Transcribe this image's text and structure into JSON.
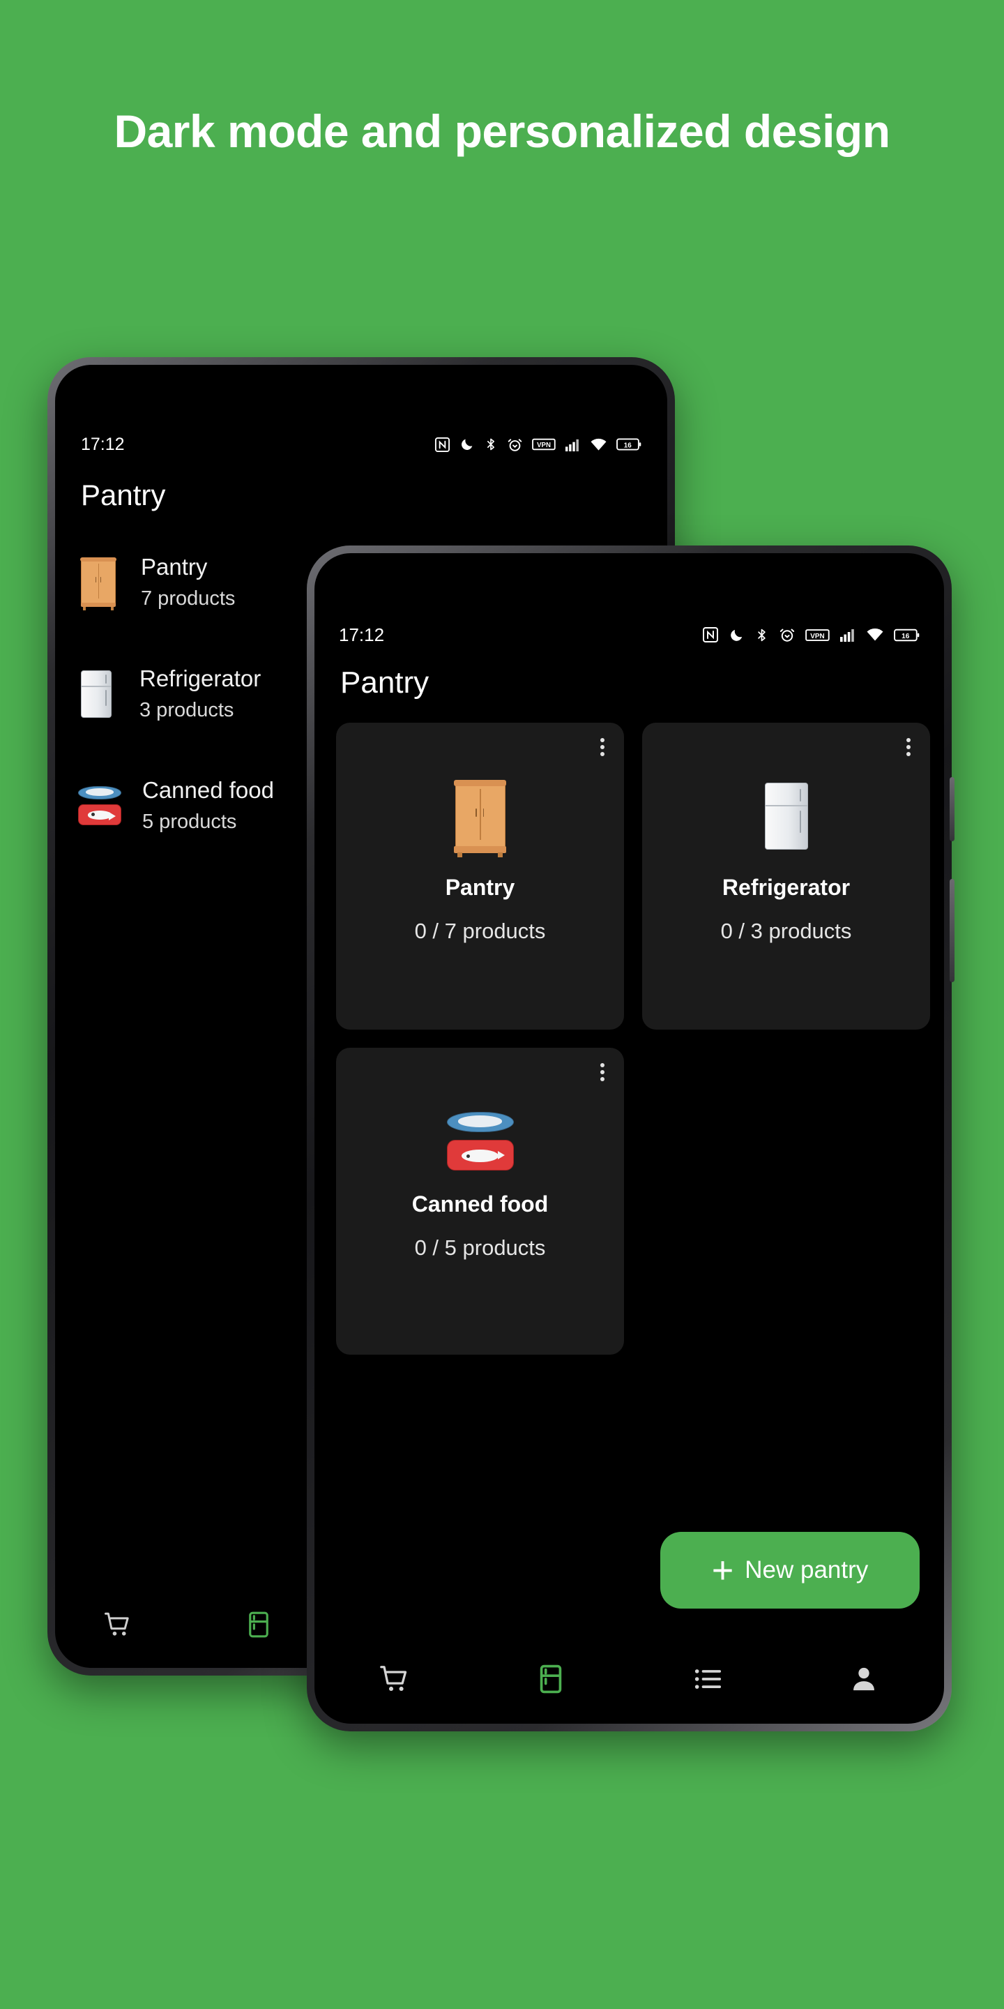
{
  "page": {
    "headline": "Dark mode and personalized design",
    "background_color": "#4CAF50",
    "accent_color": "#4CAF50",
    "surface_color": "#1b1b1b",
    "screen_background": "#000000"
  },
  "back_phone": {
    "statusbar": {
      "time": "17:12",
      "battery_label": "16",
      "icons": [
        "nfc-icon",
        "dnd-moon-icon",
        "bluetooth-icon",
        "alarm-icon",
        "vpn-icon",
        "cellular-signal-icon",
        "wifi-icon",
        "battery-icon"
      ]
    },
    "appbar": {
      "title": "Pantry"
    },
    "list": [
      {
        "emoji": "cabinet",
        "title": "Pantry",
        "subtitle": "7 products"
      },
      {
        "emoji": "fridge",
        "title": "Refrigerator",
        "subtitle": "3 products"
      },
      {
        "emoji": "can",
        "title": "Canned food",
        "subtitle": "5 products"
      }
    ],
    "bottomnav": [
      {
        "icon": "cart-icon",
        "active": false
      },
      {
        "icon": "fridge-nav-icon",
        "active": true
      }
    ]
  },
  "front_phone": {
    "statusbar": {
      "time": "17:12",
      "battery_label": "16",
      "icons": [
        "nfc-icon",
        "dnd-moon-icon",
        "bluetooth-icon",
        "alarm-icon",
        "vpn-icon",
        "cellular-signal-icon",
        "wifi-icon",
        "battery-icon"
      ]
    },
    "appbar": {
      "title": "Pantry"
    },
    "cards": [
      {
        "emoji": "cabinet",
        "title": "Pantry",
        "subtitle": "0 / 7 products"
      },
      {
        "emoji": "fridge",
        "title": "Refrigerator",
        "subtitle": "0 / 3 products"
      },
      {
        "emoji": "can",
        "title": "Canned food",
        "subtitle": "0 / 5 products"
      }
    ],
    "fab": {
      "plus": "+",
      "label": "New pantry"
    },
    "bottomnav": [
      {
        "icon": "cart-icon",
        "active": false
      },
      {
        "icon": "fridge-nav-icon",
        "active": true
      },
      {
        "icon": "list-icon",
        "active": false
      },
      {
        "icon": "person-icon",
        "active": false
      }
    ]
  }
}
